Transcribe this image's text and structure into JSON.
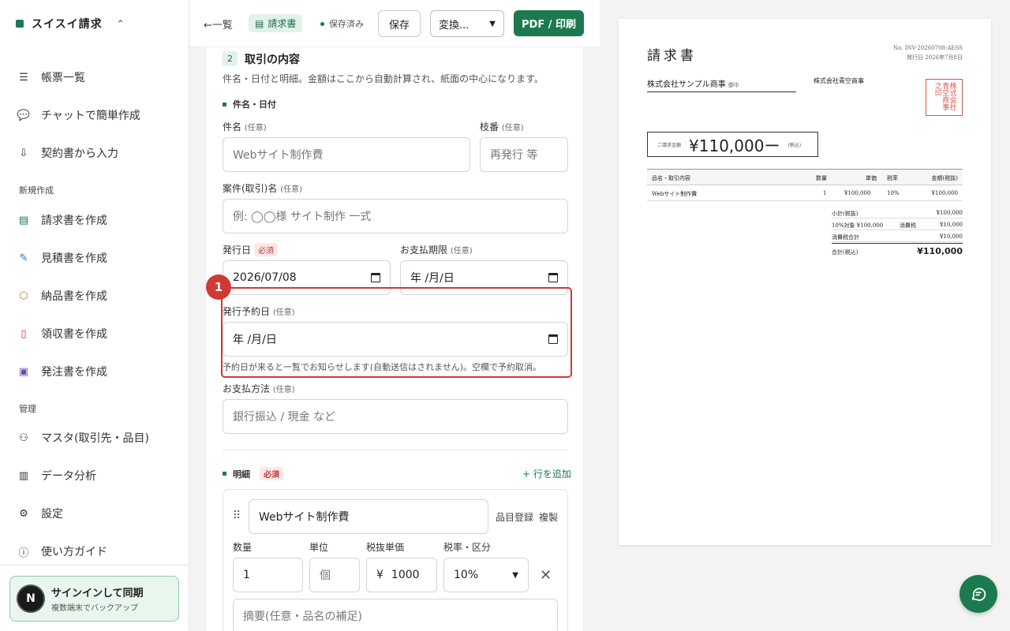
{
  "sidebar": {
    "brand": "スイスイ請求",
    "items": [
      {
        "label": "帳票一覧",
        "icon": "list-icon"
      },
      {
        "label": "チャットで簡単作成",
        "icon": "chat-icon"
      },
      {
        "label": "契約書から入力",
        "icon": "file-import-icon"
      }
    ],
    "section_new": "新規作成",
    "new_items": [
      {
        "label": "請求書を作成",
        "icon": "invoice-icon"
      },
      {
        "label": "見積書を作成",
        "icon": "estimate-icon"
      },
      {
        "label": "納品書を作成",
        "icon": "box-icon"
      },
      {
        "label": "領収書を作成",
        "icon": "receipt-icon"
      },
      {
        "label": "発注書を作成",
        "icon": "order-icon"
      }
    ],
    "section_manage": "管理",
    "manage_items": [
      {
        "label": "マスタ(取引先・品目)",
        "icon": "user-icon"
      },
      {
        "label": "データ分析",
        "icon": "chart-icon"
      },
      {
        "label": "設定",
        "icon": "gear-icon"
      },
      {
        "label": "使い方ガイド",
        "icon": "help-icon"
      }
    ],
    "signin": {
      "avatar": "N",
      "title": "サインインして同期",
      "subtitle": "複数端末でバックアップ"
    }
  },
  "toolbar": {
    "back": "←一覧",
    "doc_type": "請求書",
    "saved": "保存済み",
    "save": "保存",
    "convert": "変換...",
    "pdf": "PDF / 印刷"
  },
  "form": {
    "step": "2",
    "title": "取引の内容",
    "description": "件名・日付と明細。金額はここから自動計算され、紙面の中心になります。",
    "subhead_subject": "件名・日付",
    "subject_label": "件名",
    "optional": "(任意)",
    "subject_placeholder": "Webサイト制作費",
    "branch_label": "枝番",
    "branch_placeholder": "再発行 等",
    "case_label": "案件(取引)名",
    "case_placeholder": "例: ◯◯様 サイト制作 一式",
    "issue_date_label": "発行日",
    "required": "必須",
    "issue_date_value": "2026/07/08",
    "due_label": "お支払期限",
    "due_value": "年 /月/日",
    "scheduled_label": "発行予約日",
    "scheduled_value": "年 /月/日",
    "scheduled_hint": "予約日が来ると一覧でお知らせします(自動送信はされません)。空欄で予約取消。",
    "marker": "1",
    "payment_label": "お支払方法",
    "payment_placeholder": "銀行振込 / 現金 など",
    "lines_head": "明細",
    "add_row": "+ 行を追加",
    "line": {
      "name": "Webサイト制作費",
      "register": "品目登録",
      "duplicate": "複製",
      "qty_label": "数量",
      "unit_label": "単位",
      "price_label": "税抜単価",
      "tax_label": "税率・区分",
      "qty": "1",
      "unit_placeholder": "個",
      "currency": "¥",
      "price": "1000",
      "tax": "10%",
      "memo_placeholder": "摘要(任意・品名の補足)"
    }
  },
  "preview": {
    "title": "請求書",
    "no": "No. INV-20260708-AESS",
    "issued": "発行日 2026年7月8日",
    "to": "株式会社サンプル商事",
    "honorific": "御中",
    "from": "株式会社青空商事",
    "seal": "株式会社青空商事之印",
    "amount_label": "ご請求金額",
    "amount": "¥110,000ー",
    "tax_incl": "(税込)",
    "headers": [
      "品名・取引内容",
      "数量",
      "単価",
      "税率",
      "金額(税抜)"
    ],
    "row": [
      "Webサイト制作費",
      "1",
      "¥100,000",
      "10%",
      "¥100,000"
    ],
    "summary": [
      {
        "label": "小計(税抜)",
        "value": "¥100,000"
      },
      {
        "label": "10%対象 ¥100,000",
        "label2": "消費税",
        "value": "¥10,000"
      },
      {
        "label": "消費税合計",
        "value": "¥10,000"
      }
    ],
    "total_label": "合計(税込)",
    "total": "¥110,000"
  },
  "colors": {
    "accent": "#1b7a4e",
    "highlight": "#d03a33",
    "seal": "#d7564e"
  }
}
